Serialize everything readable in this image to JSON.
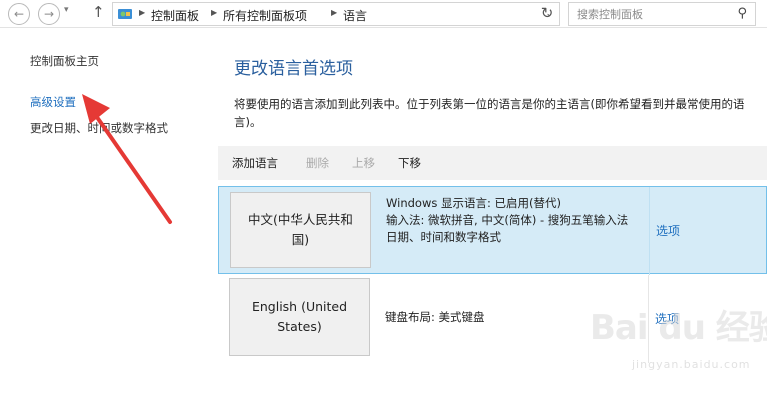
{
  "address_bar": {
    "back_icon": "arrow-left-icon",
    "forward_icon": "arrow-right-icon",
    "up_icon": "arrow-up-icon",
    "breadcrumbs": [
      "控制面板",
      "所有控制面板项",
      "语言"
    ],
    "search_placeholder": "搜索控制面板"
  },
  "left_pane": {
    "home": "控制面板主页",
    "advanced_settings": "高级设置",
    "date_format": "更改日期、时间或数字格式"
  },
  "main": {
    "title": "更改语言首选项",
    "description": "将要使用的语言添加到此列表中。位于列表第一位的语言是你的主语言(即你希望看到并最常使用的语言)。",
    "toolbar": {
      "add": "添加语言",
      "remove": "删除",
      "move_up": "上移",
      "move_down": "下移"
    },
    "languages": [
      {
        "name": "中文(中华人民共和国)",
        "details": [
          "Windows 显示语言: 已启用(替代)",
          "输入法: 微软拼音, 中文(简体) - 搜狗五笔输入法",
          "日期、时间和数字格式"
        ],
        "options": "选项"
      },
      {
        "name": "English (United States)",
        "details": [
          "键盘布局: 美式键盘"
        ],
        "options": "选项"
      }
    ]
  },
  "watermark": {
    "main": "Bai du 经验",
    "sub": "jingyan.baidu.com"
  },
  "colors": {
    "link": "#1f6fbf",
    "title": "#2a5f9e",
    "selected_row": "#d5ebf7",
    "selected_border": "#73c0ea",
    "annotation_arrow": "#e53935"
  }
}
